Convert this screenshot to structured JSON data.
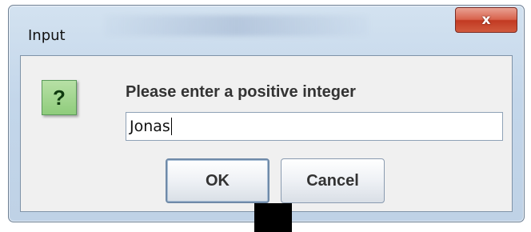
{
  "dialog": {
    "title": "Input",
    "close_label": "x",
    "icon": "question-icon",
    "icon_glyph": "?",
    "prompt": "Please enter a positive integer",
    "input_value": "Jonas",
    "ok_label": "OK",
    "cancel_label": "Cancel"
  },
  "colors": {
    "close_button": "#c23a22",
    "question_icon_bg": "#8fcc7c",
    "dialog_frame": "#c3d6ea"
  }
}
